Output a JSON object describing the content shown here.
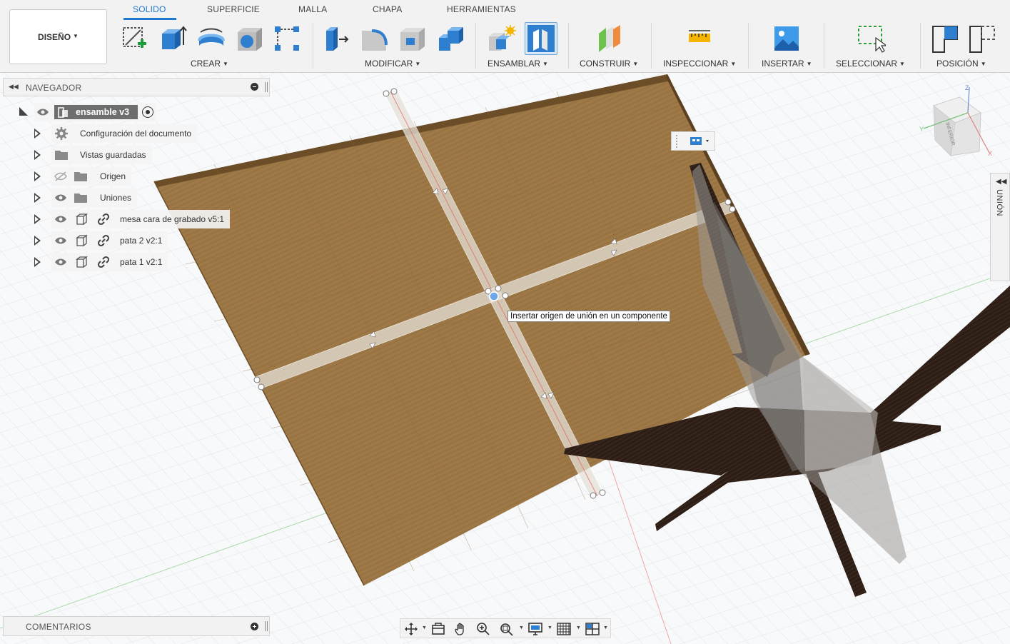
{
  "toolbar": {
    "workspace": "DISEÑO",
    "tabs": [
      "SOLIDO",
      "SUPERFICIE",
      "MALLA",
      "CHAPA",
      "HERRAMIENTAS"
    ],
    "active_tab": "SOLIDO",
    "groups": {
      "crear": "CREAR",
      "modificar": "MODIFICAR",
      "ensamblar": "ENSAMBLAR",
      "construir": "CONSTRUIR",
      "inspeccionar": "INSPECCIONAR",
      "insertar": "INSERTAR",
      "seleccionar": "SELECCIONAR",
      "posicion": "POSICIÓN"
    }
  },
  "browser": {
    "title": "NAVEGADOR",
    "root": "ensamble v3",
    "items": [
      {
        "label": "Configuración del documento",
        "icon": "gear-icon"
      },
      {
        "label": "Vistas guardadas",
        "icon": "folder-icon"
      },
      {
        "label": "Origen",
        "icon": "folder-icon",
        "hidden": true
      },
      {
        "label": "Uniones",
        "icon": "folder-icon"
      },
      {
        "label": "mesa cara de grabado v5:1",
        "icon": "component-icon",
        "linked": true
      },
      {
        "label": "pata 2 v2:1",
        "icon": "component-icon",
        "linked": true
      },
      {
        "label": "pata 1 v2:1",
        "icon": "component-icon",
        "linked": true
      }
    ]
  },
  "viewport": {
    "tooltip": "Insertar origen de unión en un componente",
    "viewcube_face": "INFERIOR",
    "side_panel": "UNIÓN"
  },
  "comments": {
    "title": "COMENTARIOS"
  },
  "colors": {
    "accent": "#1e78d2",
    "wood_light": "#9c7745",
    "wood_dark": "#2c1e16"
  }
}
